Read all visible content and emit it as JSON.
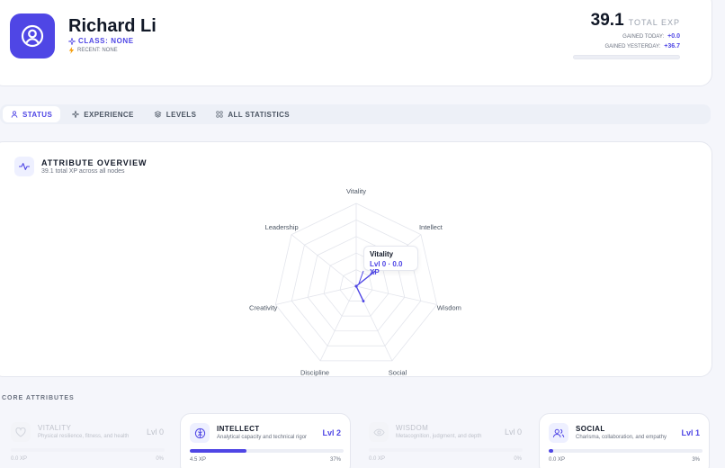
{
  "profile": {
    "name": "Richard Li",
    "class_label": "CLASS: NONE",
    "recent_label": "RECENT: NONE",
    "total_exp": "39.1",
    "total_exp_label": "TOTAL EXP",
    "gained_today_label": "GAINED TODAY:",
    "gained_today_value": "+0.0",
    "gained_yesterday_label": "GAINED YESTERDAY:",
    "gained_yesterday_value": "+36.7"
  },
  "tabs": [
    {
      "label": "STATUS",
      "icon": "user-icon",
      "active": true
    },
    {
      "label": "EXPERIENCE",
      "icon": "sparkle-icon",
      "active": false
    },
    {
      "label": "LEVELS",
      "icon": "layers-icon",
      "active": false
    },
    {
      "label": "ALL STATISTICS",
      "icon": "grid-icon",
      "active": false
    }
  ],
  "overview": {
    "title": "ATTRIBUTE OVERVIEW",
    "subtitle": "39.1 total XP across all nodes",
    "tooltip": {
      "name": "Vitality",
      "value": "Lvl 0 · 0.0 XP"
    }
  },
  "chart_data": {
    "type": "radar",
    "axes": [
      "Vitality",
      "Intellect",
      "Wisdom",
      "Social",
      "Discipline",
      "Creativity",
      "Leadership"
    ],
    "values": [
      0,
      2,
      0,
      1,
      0,
      0,
      0
    ],
    "rlim": [
      0,
      5
    ],
    "grid": true,
    "color": "#4f46e5"
  },
  "core": {
    "title": "CORE ATTRIBUTES",
    "items": [
      {
        "name": "VITALITY",
        "desc": "Physical resilience, fitness, and health",
        "level": "Lvl 0",
        "xp": "0.0 XP",
        "pct": "0%",
        "progress": 0,
        "active": false
      },
      {
        "name": "INTELLECT",
        "desc": "Analytical capacity and technical rigor",
        "level": "Lvl 2",
        "xp": "4.5 XP",
        "pct": "37%",
        "progress": 0.37,
        "active": true
      },
      {
        "name": "WISDOM",
        "desc": "Metacognition, judgment, and depth",
        "level": "Lvl 0",
        "xp": "0.0 XP",
        "pct": "0%",
        "progress": 0,
        "active": false
      },
      {
        "name": "SOCIAL",
        "desc": "Charisma, collaboration, and empathy",
        "level": "Lvl 1",
        "xp": "0.0 XP",
        "pct": "3%",
        "progress": 0.03,
        "active": true
      }
    ]
  },
  "colors": {
    "accent": "#4f46e5"
  }
}
